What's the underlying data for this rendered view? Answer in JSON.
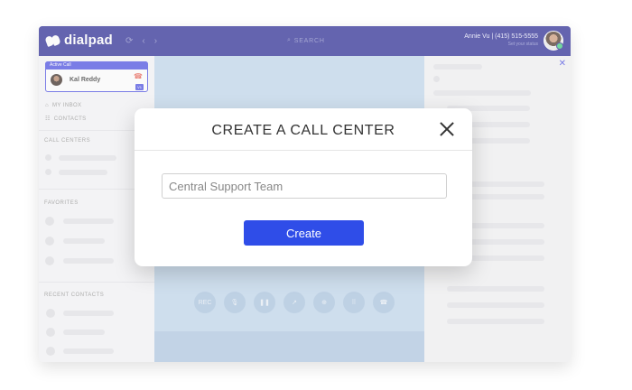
{
  "app": {
    "logo_text": "dialpad"
  },
  "topbar": {
    "search_label": "SEARCH",
    "user_name": "Annie Vu | (415) 515-5555",
    "user_status": "Set your status"
  },
  "sidebar": {
    "active_call_tag": "Active Call",
    "active_call_name": "Kal Reddy",
    "active_call_badge": "V1",
    "links": [
      "MY INBOX",
      "CONTACTS"
    ],
    "sections": {
      "call_centers": "CALL CENTERS",
      "favorites": "FAVORITES",
      "recent_contacts": "RECENT CONTACTS"
    }
  },
  "call_controls": [
    {
      "label": "REC",
      "icon": "record-icon"
    },
    {
      "label": "",
      "icon": "mute-icon"
    },
    {
      "label": "",
      "icon": "hold-icon"
    },
    {
      "label": "",
      "icon": "transfer-icon"
    },
    {
      "label": "",
      "icon": "add-caller-icon"
    },
    {
      "label": "",
      "icon": "keypad-icon"
    },
    {
      "label": "",
      "icon": "hangup-icon"
    }
  ],
  "modal": {
    "title": "CREATE A CALL CENTER",
    "input_value": "Central Support Team",
    "button_label": "Create"
  },
  "colors": {
    "brand": "#1a1a8c",
    "accent": "#2f4de8",
    "call_area": "#bcd4ec"
  }
}
